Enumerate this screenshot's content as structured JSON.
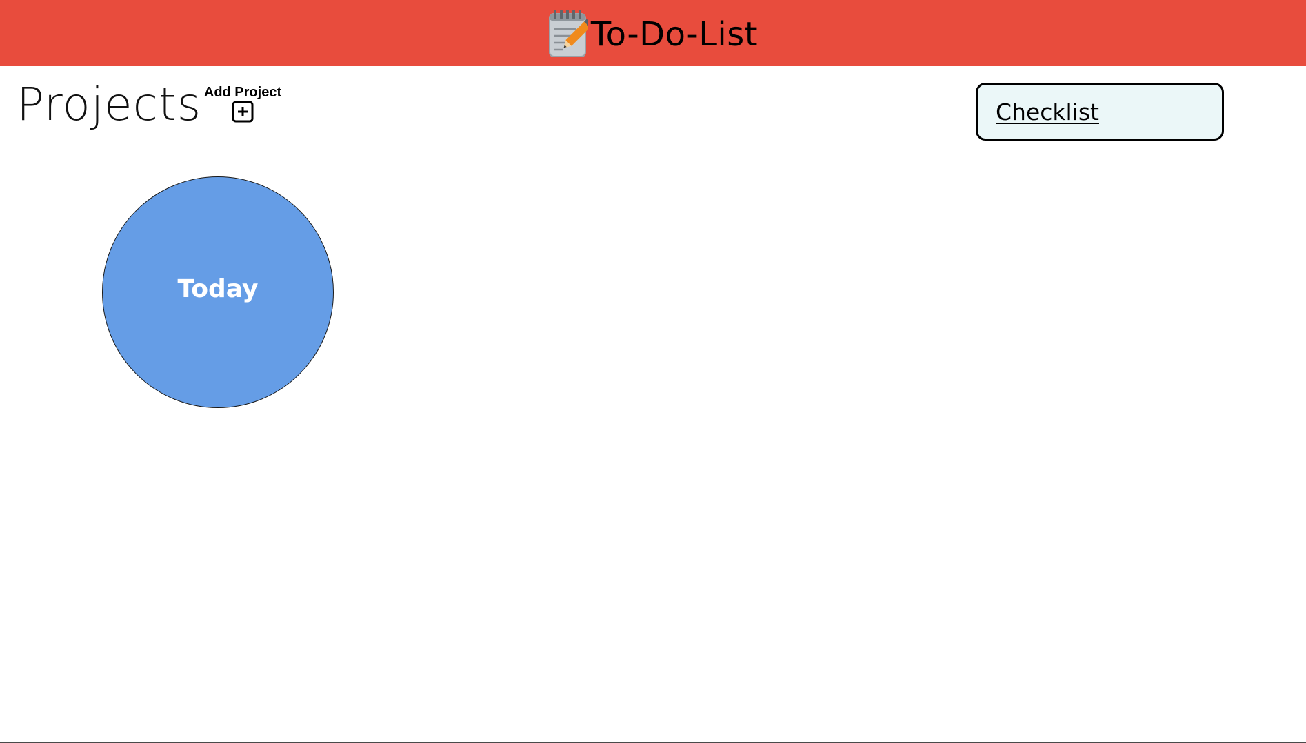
{
  "header": {
    "icon": "notepad-pencil-icon",
    "title": "To-Do-List",
    "background_color": "#e84c3d"
  },
  "projects": {
    "heading": "Projects",
    "add_project_label": "Add Project",
    "add_project_icon": "plus-square-icon",
    "items": [
      {
        "name": "Today",
        "color": "#659de6"
      }
    ]
  },
  "checklist": {
    "label": "Checklist",
    "background_color": "#ebf7f8"
  }
}
